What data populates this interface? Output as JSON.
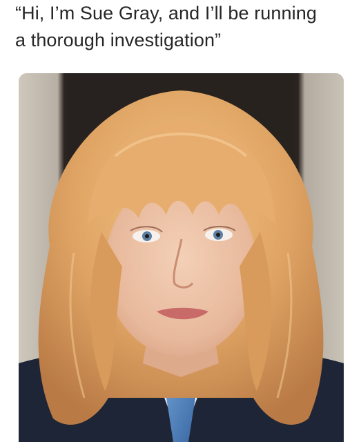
{
  "caption": {
    "line1": "“Hi, I’m Sue Gray, and I’ll be running",
    "line2": "a thorough investigation”"
  },
  "photo": {
    "subject": "portrait-photo",
    "colors": {
      "hair": "#E0A868",
      "suit": "#1E2537",
      "tie": "#4D7EB8",
      "shirt": "#F3F4F6",
      "skin": "#EBC2A6",
      "background": "#2A2421"
    }
  }
}
